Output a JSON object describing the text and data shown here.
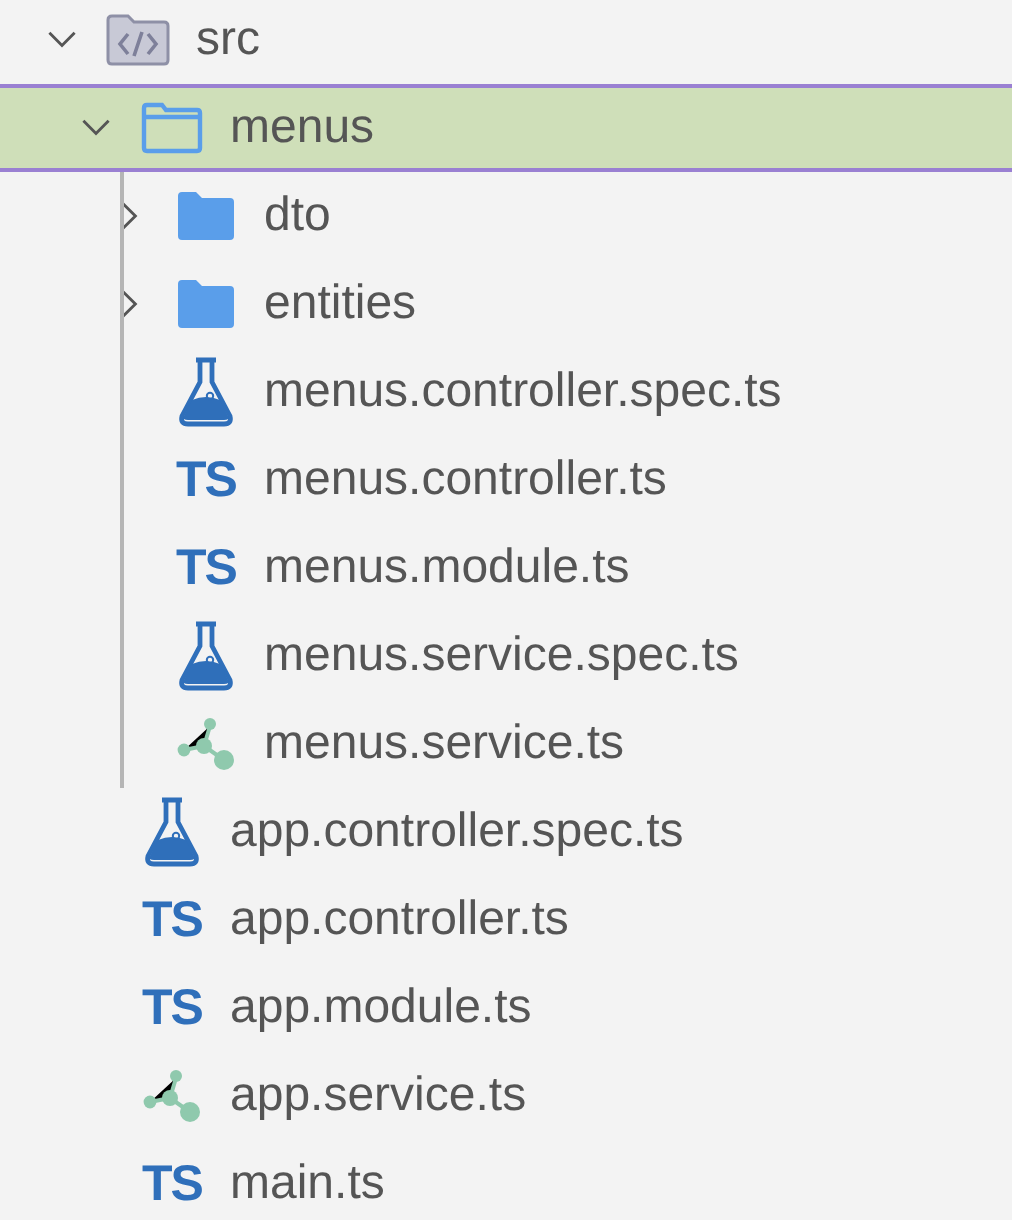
{
  "tree": [
    {
      "name": "src",
      "kind": "source-folder",
      "expanded": true,
      "selected": false,
      "children": [
        {
          "name": "menus",
          "kind": "folder",
          "expanded": true,
          "selected": true,
          "children": [
            {
              "name": "dto",
              "kind": "folder",
              "expanded": false,
              "selected": false
            },
            {
              "name": "entities",
              "kind": "folder",
              "expanded": false,
              "selected": false
            },
            {
              "name": "menus.controller.spec.ts",
              "kind": "test",
              "selected": false
            },
            {
              "name": "menus.controller.ts",
              "kind": "typescript",
              "icon_label": "TS",
              "selected": false
            },
            {
              "name": "menus.module.ts",
              "kind": "typescript",
              "icon_label": "TS",
              "selected": false
            },
            {
              "name": "menus.service.spec.ts",
              "kind": "test",
              "selected": false
            },
            {
              "name": "menus.service.ts",
              "kind": "service",
              "selected": false
            }
          ]
        },
        {
          "name": "app.controller.spec.ts",
          "kind": "test",
          "selected": false
        },
        {
          "name": "app.controller.ts",
          "kind": "typescript",
          "icon_label": "TS",
          "selected": false
        },
        {
          "name": "app.module.ts",
          "kind": "typescript",
          "icon_label": "TS",
          "selected": false
        },
        {
          "name": "app.service.ts",
          "kind": "service",
          "selected": false
        },
        {
          "name": "main.ts",
          "kind": "typescript",
          "icon_label": "TS",
          "selected": false
        }
      ]
    }
  ]
}
